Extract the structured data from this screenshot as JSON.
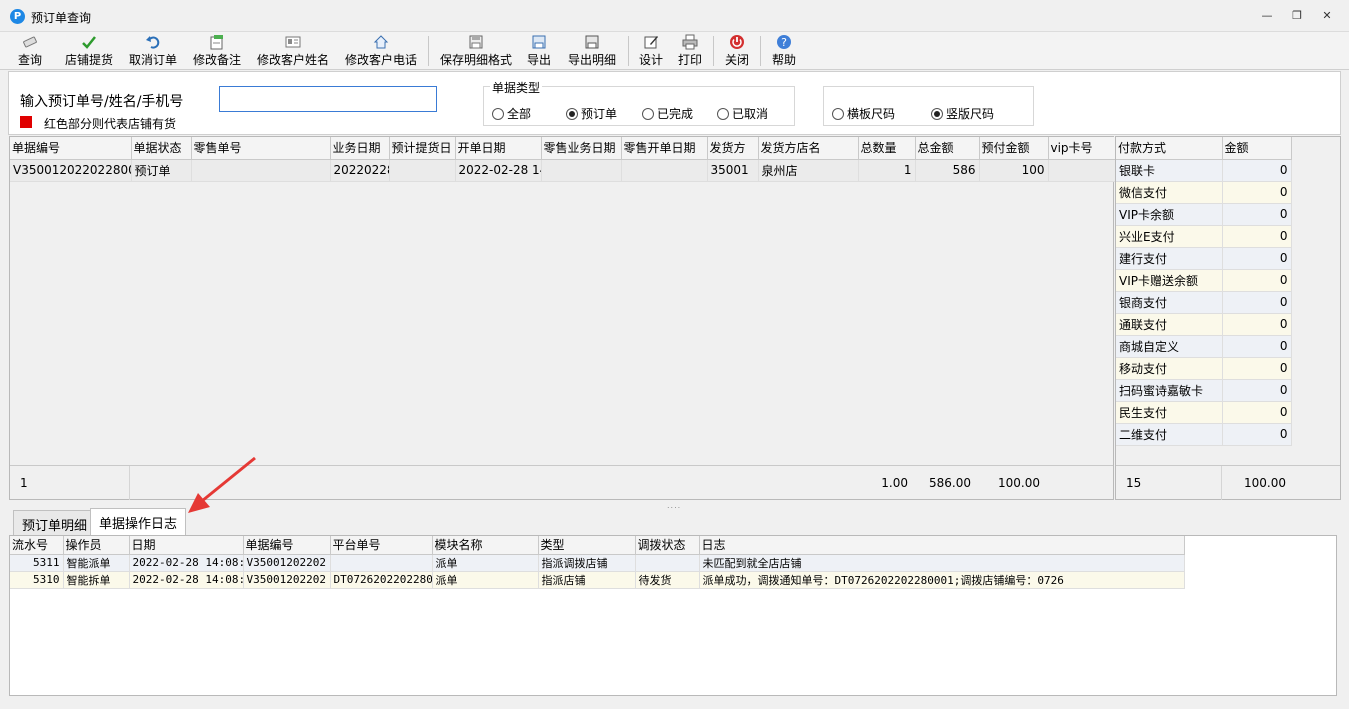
{
  "window": {
    "title": "预订单查询"
  },
  "toolbar": [
    {
      "label": "查询",
      "icon": "eraser-icon"
    },
    {
      "label": "店铺提货",
      "icon": "checkmark-icon"
    },
    {
      "label": "取消订单",
      "icon": "undo-icon"
    },
    {
      "label": "修改备注",
      "icon": "edit-note-icon"
    },
    {
      "label": "修改客户姓名",
      "icon": "id-card-icon"
    },
    {
      "label": "修改客户电话",
      "icon": "house-icon"
    },
    {
      "label": "保存明细格式",
      "icon": "save-format-icon"
    },
    {
      "label": "导出",
      "icon": "export-icon"
    },
    {
      "label": "导出明细",
      "icon": "export-detail-icon"
    },
    {
      "label": "设计",
      "icon": "design-icon"
    },
    {
      "label": "打印",
      "icon": "printer-icon"
    },
    {
      "label": "关闭",
      "icon": "power-icon"
    },
    {
      "label": "帮助",
      "icon": "help-icon"
    }
  ],
  "filter": {
    "search_label": "输入预订单号/姓名/手机号",
    "search_value": "",
    "legend_text": "红色部分则代表店铺有货",
    "doc_type_title": "单据类型",
    "doc_types": [
      {
        "label": "全部",
        "selected": false
      },
      {
        "label": "预订单",
        "selected": true
      },
      {
        "label": "已完成",
        "selected": false
      },
      {
        "label": "已取消",
        "selected": false
      }
    ],
    "size_types": [
      {
        "label": "横板尺码",
        "selected": false
      },
      {
        "label": "竖版尺码",
        "selected": true
      }
    ]
  },
  "orders": {
    "columns": [
      "单据编号",
      "单据状态",
      "零售单号",
      "业务日期",
      "预计提货日",
      "开单日期",
      "零售业务日期",
      "零售开单日期",
      "发货方",
      "发货方店名",
      "总数量",
      "总金额",
      "预付金额",
      "vip卡号"
    ],
    "rows": [
      [
        "V350012022022800(",
        "预订单",
        "",
        "20220228",
        "",
        "2022-02-28 14",
        "",
        "",
        "35001",
        "泉州店",
        "1",
        "586",
        "100",
        ""
      ]
    ],
    "footer": {
      "count": "1",
      "qty": "1.00",
      "amount": "586.00",
      "prepay": "100.00"
    }
  },
  "payments": {
    "columns": [
      "付款方式",
      "金额"
    ],
    "rows": [
      [
        "银联卡",
        "0"
      ],
      [
        "微信支付",
        "0"
      ],
      [
        "VIP卡余额",
        "0"
      ],
      [
        "兴业E支付",
        "0"
      ],
      [
        "建行支付",
        "0"
      ],
      [
        "VIP卡赠送余额",
        "0"
      ],
      [
        "银商支付",
        "0"
      ],
      [
        "通联支付",
        "0"
      ],
      [
        "商城自定义",
        "0"
      ],
      [
        "移动支付",
        "0"
      ],
      [
        "扫码蜜诗嘉敏卡",
        "0"
      ],
      [
        "民生支付",
        "0"
      ],
      [
        "二维支付",
        "0"
      ]
    ],
    "footer": {
      "count": "15",
      "total": "100.00"
    }
  },
  "tabs": [
    {
      "label": "预订单明细",
      "active": false
    },
    {
      "label": "单据操作日志",
      "active": true
    }
  ],
  "log": {
    "columns": [
      "流水号",
      "操作员",
      "日期",
      "单据编号",
      "平台单号",
      "模块名称",
      "类型",
      "调拨状态",
      "日志"
    ],
    "rows": [
      [
        "5311",
        "智能派单",
        "2022-02-28 14:08:5",
        "V35001202202",
        "",
        "派单",
        "指派调拨店铺",
        "",
        "未匹配到就全店店铺"
      ],
      [
        "5310",
        "智能拆单",
        "2022-02-28 14:08:5",
        "V35001202202",
        "DT07262022022800",
        "派单",
        "指派店铺",
        "待发货",
        "派单成功，调拨通知单号：DT0726202202280001;调拨店铺编号：0726"
      ]
    ]
  },
  "colors": {
    "accent": "#3a7bd5",
    "legend_red": "#e00000",
    "arrow": "#e53935"
  }
}
